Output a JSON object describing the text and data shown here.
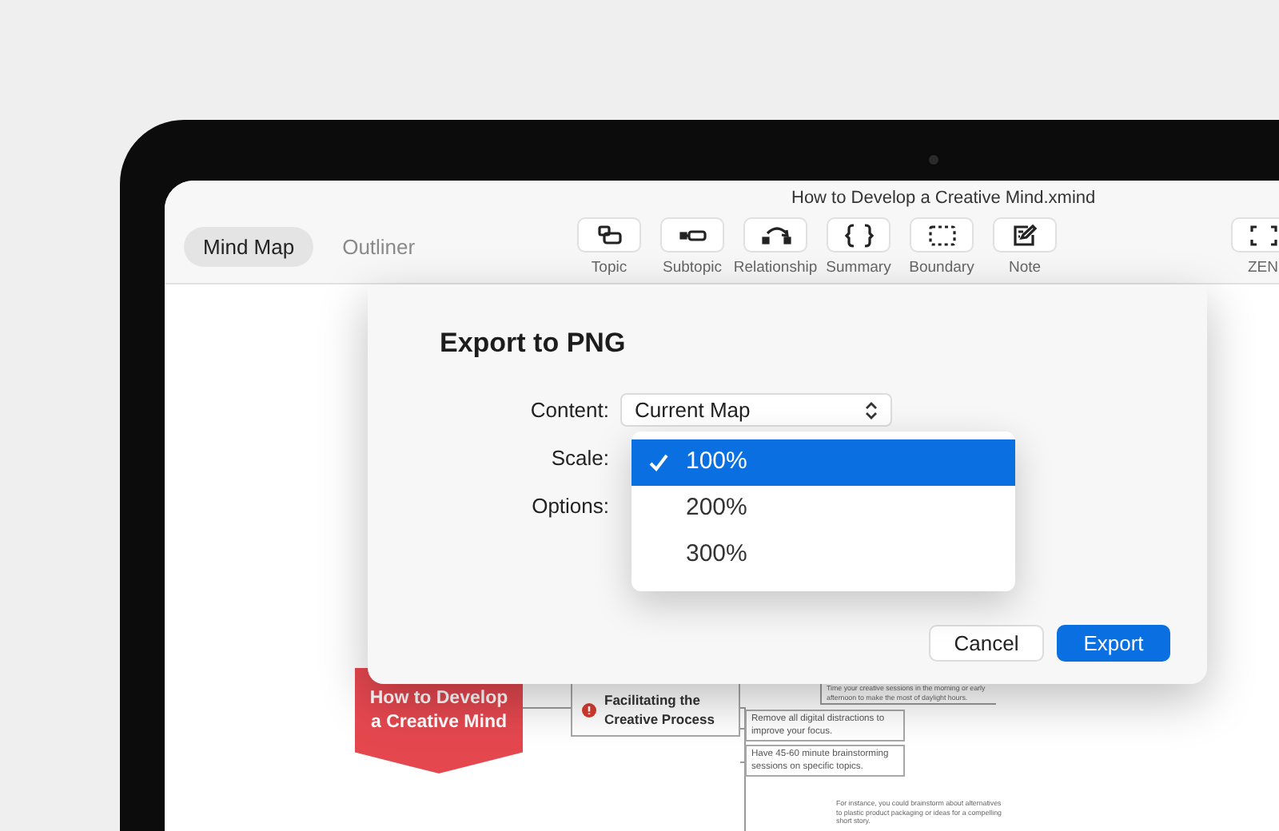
{
  "window": {
    "title": "How to Develop a Creative Mind.xmind"
  },
  "view_tabs": [
    {
      "label": "Mind Map",
      "selected": true
    },
    {
      "label": "Outliner",
      "selected": false
    }
  ],
  "toolbar": [
    {
      "label": "Topic"
    },
    {
      "label": "Subtopic"
    },
    {
      "label": "Relationship"
    },
    {
      "label": "Summary"
    },
    {
      "label": "Boundary"
    },
    {
      "label": "Note"
    },
    {
      "label": "ZEN"
    }
  ],
  "mind_map": {
    "central_topic": "How to Develop a Creative Mind",
    "main_topic": "Facilitating the Creative Process",
    "subtopics": [
      "Remove all digital distractions to improve your focus.",
      "Have 45-60 minute brainstorming sessions on specific topics."
    ],
    "notes": [
      "Time your creative sessions in the morning or early afternoon to make the most of daylight hours.",
      "For instance, you could brainstorm about alternatives to plastic product packaging or ideas for a compelling short story."
    ]
  },
  "dialog": {
    "title": "Export to PNG",
    "content_label": "Content:",
    "content_value": "Current Map",
    "scale_label": "Scale:",
    "options_label": "Options:",
    "scale_menu": [
      {
        "label": "100%",
        "selected": true
      },
      {
        "label": "200%",
        "selected": false
      },
      {
        "label": "300%",
        "selected": false
      }
    ],
    "buttons": [
      {
        "label": "Cancel",
        "kind": "secondary"
      },
      {
        "label": "Export",
        "kind": "primary"
      }
    ]
  }
}
